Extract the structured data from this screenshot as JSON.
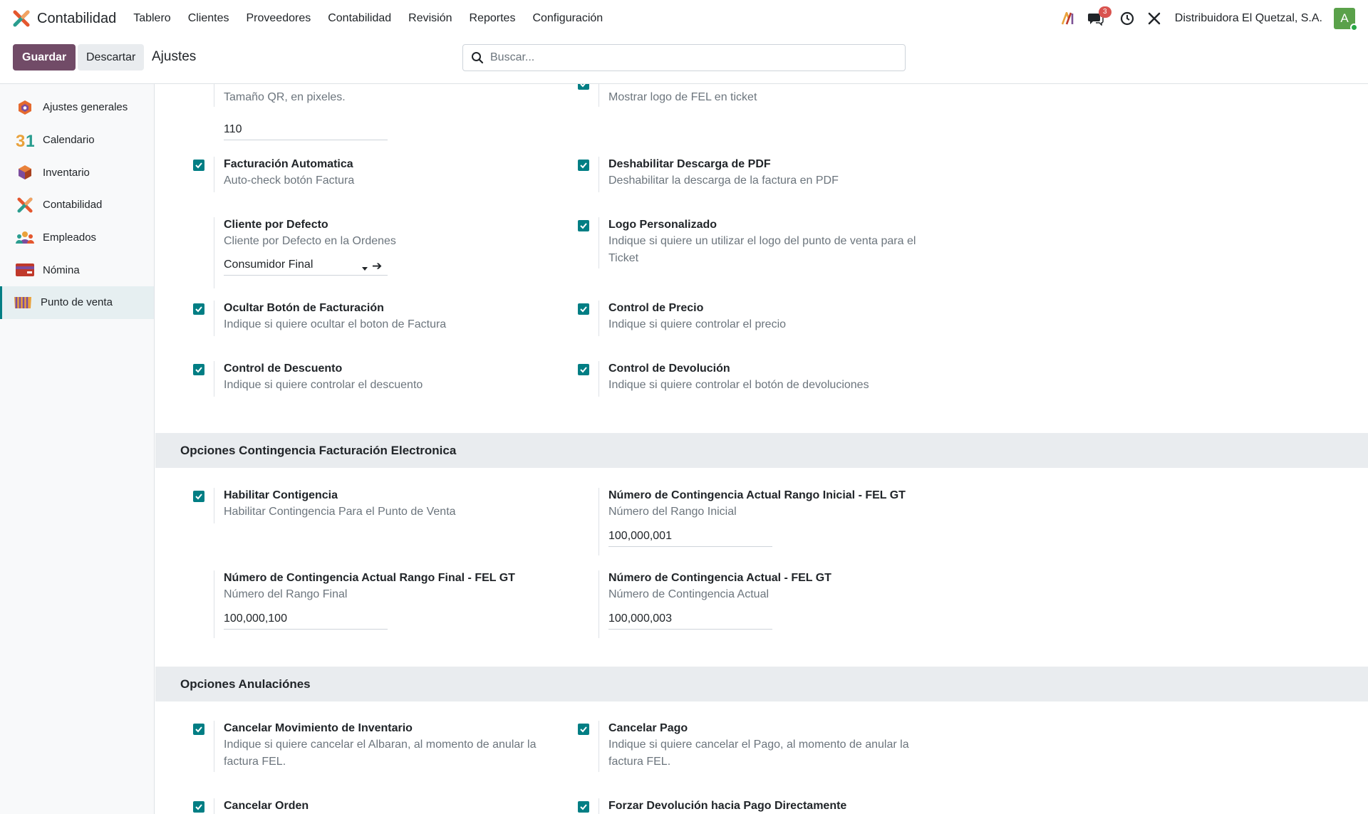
{
  "navbar": {
    "app_name": "Contabilidad",
    "menu": [
      "Tablero",
      "Clientes",
      "Proveedores",
      "Contabilidad",
      "Revisión",
      "Reportes",
      "Configuración"
    ],
    "messages_count": "3",
    "company": "Distribuidora El Quetzal, S.A.",
    "avatar_letter": "A"
  },
  "control": {
    "save_label": "Guardar",
    "discard_label": "Descartar",
    "title": "Ajustes",
    "search_placeholder": "Buscar..."
  },
  "sidebar": {
    "items": [
      {
        "label": "Ajustes generales",
        "icon": "settings-hex-icon"
      },
      {
        "label": "Calendario",
        "icon": "calendar-icon"
      },
      {
        "label": "Inventario",
        "icon": "inventory-box-icon"
      },
      {
        "label": "Contabilidad",
        "icon": "accounting-icon"
      },
      {
        "label": "Empleados",
        "icon": "employees-icon"
      },
      {
        "label": "Nómina",
        "icon": "payroll-card-icon"
      },
      {
        "label": "Punto de venta",
        "icon": "pos-store-icon"
      }
    ],
    "active_index": 6
  },
  "settings": {
    "qr_size": {
      "desc": "Tamaño QR, en pixeles.",
      "value": "110"
    },
    "show_logo": {
      "desc": "Mostrar logo de FEL en ticket"
    },
    "auto_invoice": {
      "title": "Facturación Automatica",
      "desc": "Auto-check botón Factura"
    },
    "disable_pdf": {
      "title": "Deshabilitar Descarga de PDF",
      "desc": "Deshabilitar la descarga de la factura en PDF"
    },
    "default_client": {
      "title": "Cliente por Defecto",
      "desc": "Cliente por Defecto en la Ordenes",
      "value": "Consumidor Final"
    },
    "custom_logo": {
      "title": "Logo Personalizado",
      "desc": "Indique si quiere un utilizar el logo del punto de venta para el Ticket"
    },
    "hide_invoice_btn": {
      "title": "Ocultar Botón de Facturación",
      "desc": "Indique si quiere ocultar el boton de Factura"
    },
    "price_control": {
      "title": "Control de Precio",
      "desc": "Indique si quiere controlar el precio"
    },
    "discount_control": {
      "title": "Control de Descuento",
      "desc": "Indique si quiere controlar el descuento"
    },
    "return_control": {
      "title": "Control de Devolución",
      "desc": "Indique si quiere controlar el botón de devoluciones"
    }
  },
  "contingency": {
    "header": "Opciones Contingencia Facturación Electronica",
    "enable": {
      "title": "Habilitar Contigencia",
      "desc": "Habilitar Contingencia Para el Punto de Venta"
    },
    "range_start": {
      "title": "Número de Contingencia Actual Rango Inicial - FEL GT",
      "desc": "Número del Rango Inicial",
      "value": "100,000,001"
    },
    "range_end": {
      "title": "Número de Contingencia Actual Rango Final - FEL GT",
      "desc": "Número del Rango Final",
      "value": "100,000,100"
    },
    "current": {
      "title": "Número de Contingencia Actual - FEL GT",
      "desc": "Número de Contingencia Actual",
      "value": "100,000,003"
    }
  },
  "cancellations": {
    "header": "Opciones Anulaciónes",
    "inventory": {
      "title": "Cancelar Movimiento de Inventario",
      "desc": "Indique si quiere cancelar el Albaran, al momento de anular la factura FEL."
    },
    "payment": {
      "title": "Cancelar Pago",
      "desc": "Indique si quiere cancelar el Pago, al momento de anular la factura FEL."
    },
    "order": {
      "title": "Cancelar Orden"
    },
    "force_refund": {
      "title": "Forzar Devolución hacia Pago Directamente"
    }
  },
  "colors": {
    "brand": "#714b67",
    "accent": "#017e84",
    "badge": "#d9534f"
  }
}
